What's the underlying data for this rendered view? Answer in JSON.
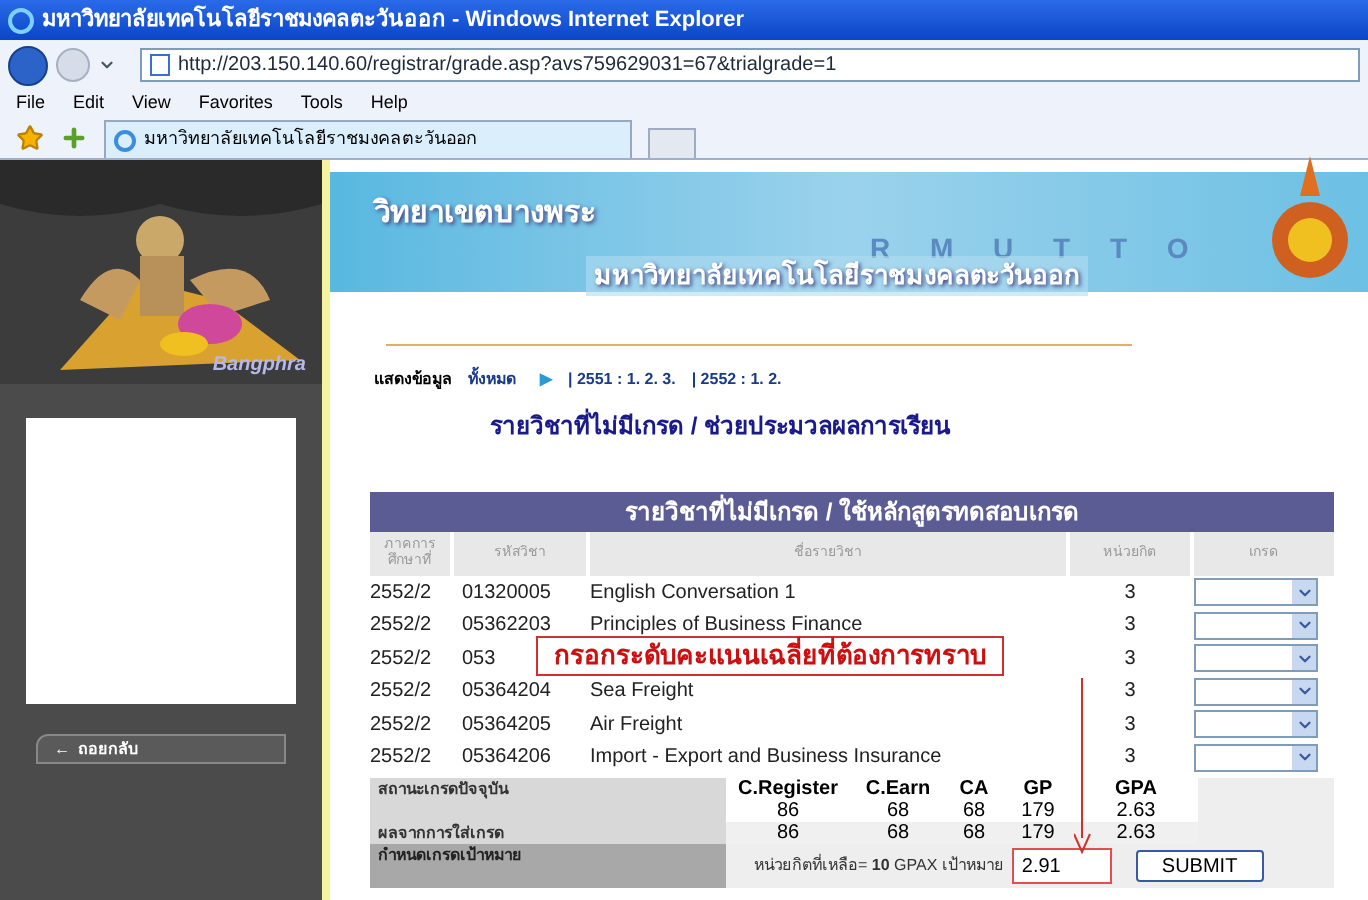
{
  "window": {
    "title": "มหาวิทยาลัยเทคโนโลยีราชมงคลตะวันออก - Windows Internet Explorer"
  },
  "address_bar": {
    "url": "http://203.150.140.60/registrar/grade.asp?avs759629031=67&trialgrade=1"
  },
  "menu": [
    "File",
    "Edit",
    "View",
    "Favorites",
    "Tools",
    "Help"
  ],
  "tab": {
    "label": "มหาวิทยาลัยเทคโนโลยีราชมงคลตะวันออก"
  },
  "sidebar": {
    "caption": "Bangphra",
    "back_button": {
      "icon": "←",
      "label": "ถอยกลับ"
    }
  },
  "banner": {
    "campus": "วิทยาเขตบางพระ",
    "letters": "R M U T T O",
    "university": "มหาวิทยาลัยเทคโนโลยีราชมงคลตะวันออก"
  },
  "filter": {
    "label": "แสดงข้อมูล",
    "all": "ทั้งหมด",
    "arrow": "▶",
    "links": [
      "| 2551 : 1. 2. 3.",
      "| 2552 : 1. 2."
    ]
  },
  "heading": "รายวิชาที่ไม่มีเกรด / ช่วยประมวลผลการเรียน",
  "table": {
    "title": "รายวิชาที่ไม่มีเกรด / ใช้หลักสูตรทดสอบเกรด",
    "columns": [
      "ภาคการศึกษาที่",
      "รหัสวิชา",
      "ชื่อรายวิชา",
      "หน่วยกิต",
      "เกรด"
    ],
    "rows": [
      {
        "term": "2552/2",
        "code": "01320005",
        "name": "English Conversation 1",
        "credits": "3"
      },
      {
        "term": "2552/2",
        "code": "05362203",
        "name": "Principles of Business Finance",
        "credits": "3"
      },
      {
        "term": "2552/2",
        "code": "053",
        "credits": "3"
      },
      {
        "term": "2552/2",
        "code": "05364204",
        "name": "Sea Freight",
        "credits": "3"
      },
      {
        "term": "2552/2",
        "code": "05364205",
        "name": "Air Freight",
        "credits": "3"
      },
      {
        "term": "2552/2",
        "code": "05364206",
        "name": "Import - Export and Business Insurance",
        "credits": "3"
      }
    ]
  },
  "callout": "กรอกระดับคะแนนเฉลี่ยที่ต้องการทราบ",
  "summary": {
    "headers": [
      "C.Register",
      "C.Earn",
      "CA",
      "GP",
      "GPA"
    ],
    "current": {
      "label": "สถานะเกรดปัจจุบัน",
      "values": [
        "86",
        "68",
        "68",
        "179",
        "2.63"
      ]
    },
    "result": {
      "label": "ผลจากการใส่เกรด",
      "values": [
        "86",
        "68",
        "68",
        "179",
        "2.63"
      ]
    },
    "target": {
      "label": "กำหนดเกรดเป้าหมาย",
      "remaining": "หน่วยกิตที่เหลือ= **10** GPAX เป้าหมาย",
      "value": "2.91",
      "submit": "SUBMIT"
    }
  }
}
